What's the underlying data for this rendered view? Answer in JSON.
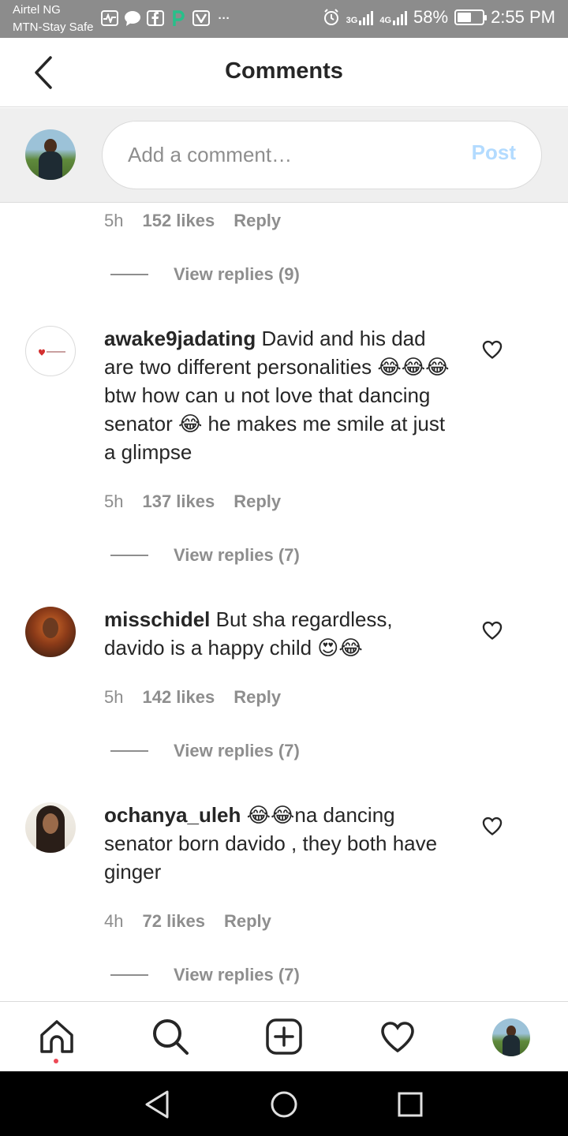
{
  "status_bar": {
    "carrier_1": "Airtel NG",
    "carrier_2": "MTN-Stay Safe",
    "more": "···",
    "net_1": "3G",
    "net_2": "4G",
    "battery": "58%",
    "battery_level": 0.58,
    "time": "2:55 PM"
  },
  "header": {
    "title": "Comments"
  },
  "composer": {
    "placeholder": "Add a comment…",
    "post_label": "Post"
  },
  "top_meta": {
    "time": "5h",
    "likes": "152 likes",
    "reply": "Reply"
  },
  "top_view_replies": "View replies (9)",
  "comments": [
    {
      "username": "awake9jadating",
      "text": "David and his dad are two different personalities 😂😂😂 btw how can u not love that dancing senator 😂 he makes me smile at just a glimpse",
      "time": "5h",
      "likes": "137 likes",
      "reply": "Reply",
      "view_replies": "View replies (7)"
    },
    {
      "username": "misschidel",
      "text": "But sha regardless, davido is a happy child 😍😂",
      "time": "5h",
      "likes": "142 likes",
      "reply": "Reply",
      "view_replies": "View replies (7)"
    },
    {
      "username": "ochanya_uleh",
      "text": "😂😂na dancing senator born davido , they both have ginger",
      "time": "4h",
      "likes": "72 likes",
      "reply": "Reply",
      "view_replies": "View replies (7)"
    }
  ],
  "icons": {
    "back": "chevron-left-icon",
    "heart": "heart-outline-icon",
    "nav": [
      "home-icon",
      "search-icon",
      "add-post-icon",
      "activity-heart-icon",
      "profile-avatar"
    ],
    "system": [
      "android-back-icon",
      "android-home-icon",
      "android-recents-icon"
    ]
  },
  "colors": {
    "post_disabled": "#b3dbff",
    "notification_dot": "#ed4956",
    "meta_grey": "#8e8e8e"
  }
}
